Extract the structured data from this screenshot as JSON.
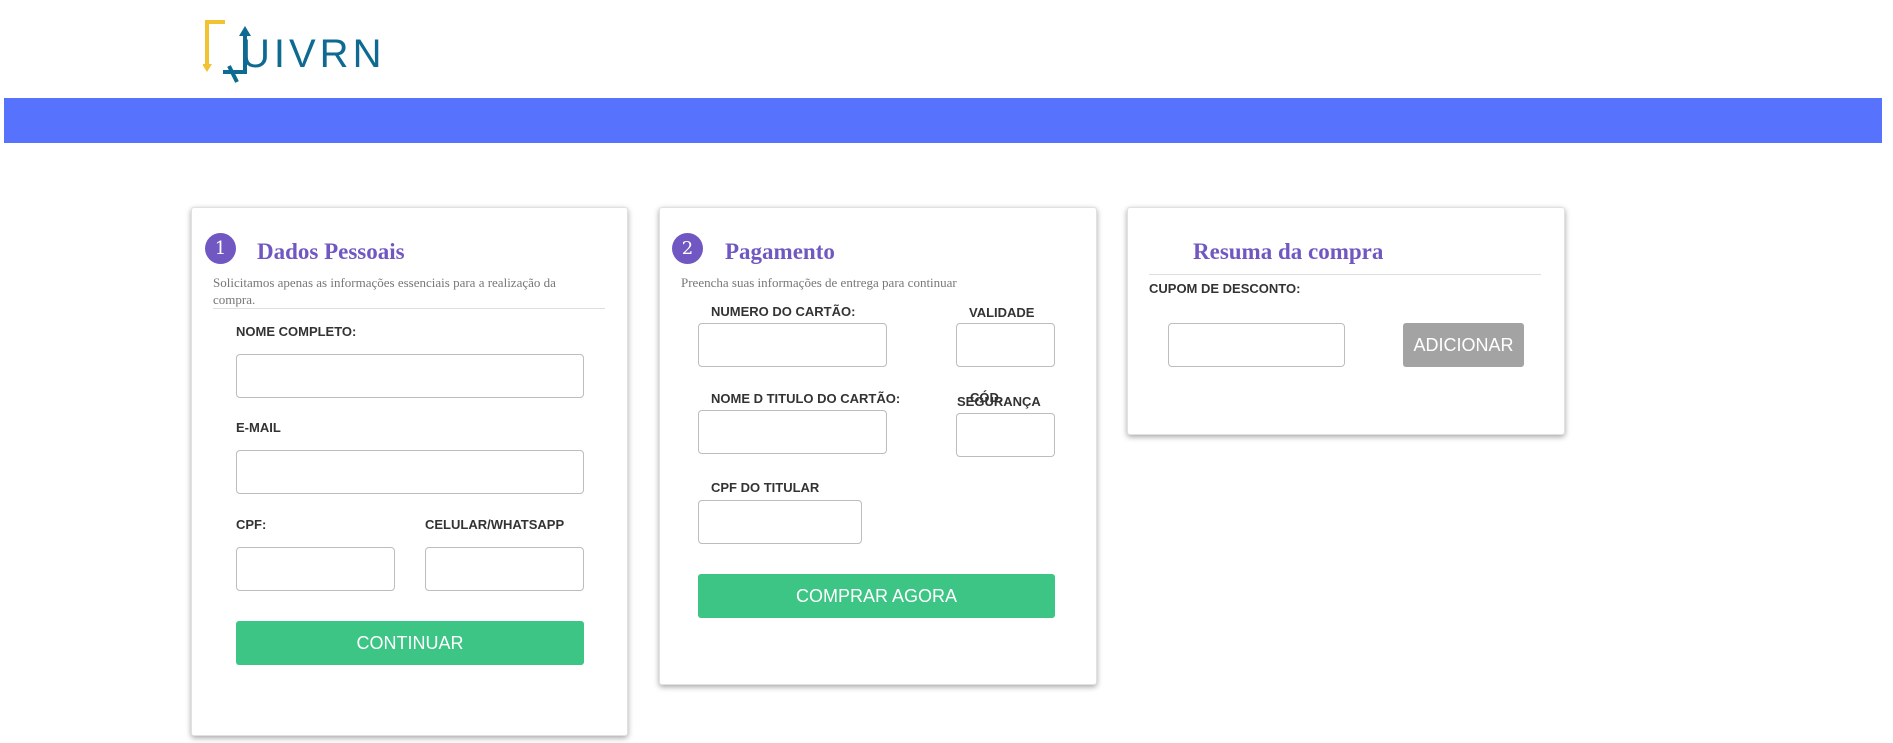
{
  "brand": {
    "logo_text": "UIVRN",
    "banner_color": "#5772fd"
  },
  "colors": {
    "accent": "#7157c2",
    "button_green": "#3cc585",
    "button_gray": "#a3a3a3"
  },
  "personal": {
    "step": "1",
    "title": "Dados Pessoais",
    "subtitle": "Solicitamos apenas as informações essenciais para a realização da compra.",
    "name_label": "NOME COMPLETO:",
    "email_label": "E-MAIL",
    "cpf_label": "CPF:",
    "phone_label": "CELULAR/WHATSAPP",
    "continue_label": "CONTINUAR"
  },
  "payment": {
    "step": "2",
    "title": "Pagamento",
    "subtitle": "Preencha suas informações de entrega para continuar",
    "card_number_label": "NUMERO DO CARTÃO:",
    "validity_label": "VALIDADE",
    "holder_name_label": "NOME D TITULO DO CARTÃO:",
    "security_label_1": "CÓD.",
    "security_label_2": "SEGURANÇA",
    "holder_cpf_label": "CPF DO TITULAR",
    "buy_label": "COMPRAR AGORA"
  },
  "summary": {
    "title": "Resuma da compra",
    "coupon_label": "CUPOM DE DESCONTO:",
    "add_label": "ADICIONAR"
  }
}
